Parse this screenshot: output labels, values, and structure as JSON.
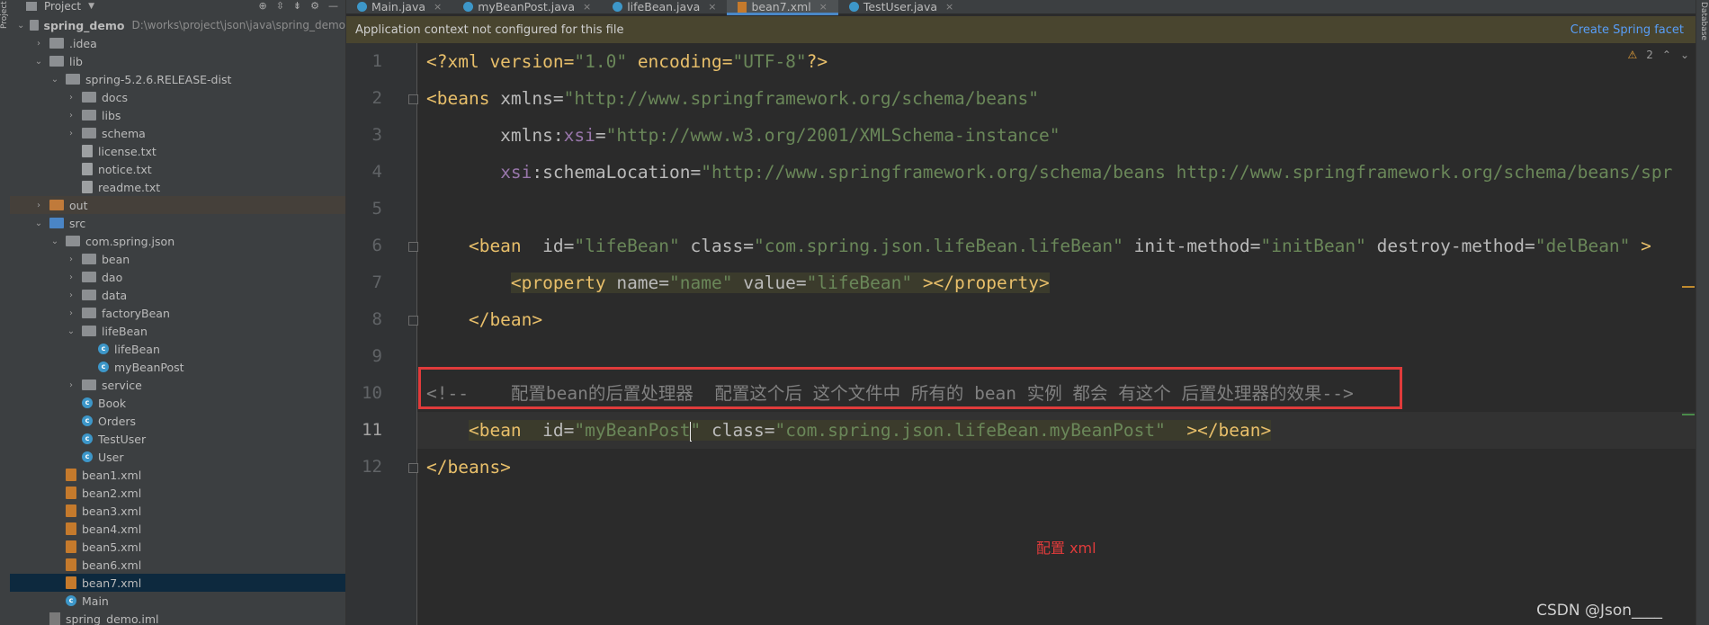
{
  "tool_windows": {
    "left": "Project",
    "right": "Database"
  },
  "project_panel": {
    "title": "Project",
    "tree": [
      {
        "label": "spring_demo",
        "path": "D:\\works\\project\\json\\java\\spring_demo",
        "depth": 0,
        "expanded": true,
        "kind": "module"
      },
      {
        "label": ".idea",
        "depth": 1,
        "expanded": false,
        "kind": "folder-grey"
      },
      {
        "label": "lib",
        "depth": 1,
        "expanded": true,
        "kind": "folder-grey"
      },
      {
        "label": "spring-5.2.6.RELEASE-dist",
        "depth": 2,
        "expanded": true,
        "kind": "folder-grey"
      },
      {
        "label": "docs",
        "depth": 3,
        "expanded": false,
        "kind": "folder-grey"
      },
      {
        "label": "libs",
        "depth": 3,
        "expanded": false,
        "kind": "folder-grey"
      },
      {
        "label": "schema",
        "depth": 3,
        "expanded": false,
        "kind": "folder-grey"
      },
      {
        "label": "license.txt",
        "depth": 3,
        "kind": "file"
      },
      {
        "label": "notice.txt",
        "depth": 3,
        "kind": "file"
      },
      {
        "label": "readme.txt",
        "depth": 3,
        "kind": "file"
      },
      {
        "label": "out",
        "depth": 1,
        "expanded": false,
        "kind": "folder-orange",
        "highlight": true
      },
      {
        "label": "src",
        "depth": 1,
        "expanded": true,
        "kind": "folder-src"
      },
      {
        "label": "com.spring.json",
        "depth": 2,
        "expanded": true,
        "kind": "package"
      },
      {
        "label": "bean",
        "depth": 3,
        "expanded": false,
        "kind": "package"
      },
      {
        "label": "dao",
        "depth": 3,
        "expanded": false,
        "kind": "package"
      },
      {
        "label": "data",
        "depth": 3,
        "expanded": false,
        "kind": "package"
      },
      {
        "label": "factoryBean",
        "depth": 3,
        "expanded": false,
        "kind": "package"
      },
      {
        "label": "lifeBean",
        "depth": 3,
        "expanded": true,
        "kind": "package"
      },
      {
        "label": "lifeBean",
        "depth": 4,
        "kind": "class"
      },
      {
        "label": "myBeanPost",
        "depth": 4,
        "kind": "class"
      },
      {
        "label": "service",
        "depth": 3,
        "expanded": false,
        "kind": "package"
      },
      {
        "label": "Book",
        "depth": 3,
        "kind": "class"
      },
      {
        "label": "Orders",
        "depth": 3,
        "kind": "class"
      },
      {
        "label": "TestUser",
        "depth": 3,
        "kind": "class"
      },
      {
        "label": "User",
        "depth": 3,
        "kind": "class"
      },
      {
        "label": "bean1.xml",
        "depth": 2,
        "kind": "xml"
      },
      {
        "label": "bean2.xml",
        "depth": 2,
        "kind": "xml"
      },
      {
        "label": "bean3.xml",
        "depth": 2,
        "kind": "xml"
      },
      {
        "label": "bean4.xml",
        "depth": 2,
        "kind": "xml"
      },
      {
        "label": "bean5.xml",
        "depth": 2,
        "kind": "xml"
      },
      {
        "label": "bean6.xml",
        "depth": 2,
        "kind": "xml"
      },
      {
        "label": "bean7.xml",
        "depth": 2,
        "kind": "xml",
        "selected": true
      },
      {
        "label": "Main",
        "depth": 2,
        "kind": "class"
      },
      {
        "label": "spring_demo.iml",
        "depth": 1,
        "kind": "iml"
      }
    ]
  },
  "tabs": [
    {
      "label": "Main.java",
      "icon": "class",
      "active": false
    },
    {
      "label": "myBeanPost.java",
      "icon": "class",
      "active": false
    },
    {
      "label": "lifeBean.java",
      "icon": "class",
      "active": false
    },
    {
      "label": "bean7.xml",
      "icon": "xml",
      "active": true
    },
    {
      "label": "TestUser.java",
      "icon": "class",
      "active": false
    }
  ],
  "banner": {
    "message": "Application context not configured for this file",
    "action": "Create Spring facet"
  },
  "inspections": {
    "warnings": "2"
  },
  "editor": {
    "current_line": 11,
    "lines": [
      {
        "n": "1",
        "tokens": [
          {
            "t": "<?xml version=",
            "c": "t-tag"
          },
          {
            "t": "\"1.0\"",
            "c": "t-val"
          },
          {
            "t": " encoding=",
            "c": "t-tag"
          },
          {
            "t": "\"UTF-8\"",
            "c": "t-val"
          },
          {
            "t": "?>",
            "c": "t-tag"
          }
        ]
      },
      {
        "n": "2",
        "tokens": [
          {
            "t": "<beans ",
            "c": "t-tag"
          },
          {
            "t": "xmlns=",
            "c": "t-attr"
          },
          {
            "t": "\"http://www.springframework.org/schema/beans\"",
            "c": "t-val"
          }
        ]
      },
      {
        "n": "3",
        "tokens": [
          {
            "t": "       xmlns:",
            "c": "t-attr"
          },
          {
            "t": "xsi",
            "c": "t-ns"
          },
          {
            "t": "=",
            "c": "t-attr"
          },
          {
            "t": "\"http://www.w3.org/2001/XMLSchema-instance\"",
            "c": "t-val"
          }
        ]
      },
      {
        "n": "4",
        "tokens": [
          {
            "t": "       ",
            "c": "t-attr"
          },
          {
            "t": "xsi",
            "c": "t-ns"
          },
          {
            "t": ":schemaLocation=",
            "c": "t-attr"
          },
          {
            "t": "\"http://www.springframework.org/schema/beans http://www.springframework.org/schema/beans/spr",
            "c": "t-val"
          }
        ]
      },
      {
        "n": "5",
        "tokens": []
      },
      {
        "n": "6",
        "tokens": [
          {
            "t": "    <bean  ",
            "c": "t-tag"
          },
          {
            "t": "id=",
            "c": "t-attr"
          },
          {
            "t": "\"lifeBean\"",
            "c": "t-val"
          },
          {
            "t": " class=",
            "c": "t-attr"
          },
          {
            "t": "\"com.spring.json.lifeBean.lifeBean\"",
            "c": "t-val"
          },
          {
            "t": " init-method=",
            "c": "t-attr"
          },
          {
            "t": "\"initBean\"",
            "c": "t-val"
          },
          {
            "t": " destroy-method=",
            "c": "t-attr"
          },
          {
            "t": "\"delBean\"",
            "c": "t-val"
          },
          {
            "t": " >",
            "c": "t-tag"
          }
        ]
      },
      {
        "n": "7",
        "tokens": [
          {
            "t": "        ",
            "c": ""
          },
          {
            "t": "<property ",
            "c": "t-tag hl-tag"
          },
          {
            "t": "name=",
            "c": "t-attr hl-tag"
          },
          {
            "t": "\"name\"",
            "c": "t-val hl-tag"
          },
          {
            "t": " value=",
            "c": "t-attr hl-tag"
          },
          {
            "t": "\"lifeBean\"",
            "c": "t-val hl-tag"
          },
          {
            "t": " ></property>",
            "c": "t-tag hl-tag"
          }
        ]
      },
      {
        "n": "8",
        "tokens": [
          {
            "t": "    </bean>",
            "c": "t-tag"
          }
        ]
      },
      {
        "n": "9",
        "tokens": []
      },
      {
        "n": "10",
        "tokens": [
          {
            "t": "<!--    配置bean的后置处理器  配置这个后 这个文件中 所有的 bean 实例 都会 有这个 后置处理器的效果-->",
            "c": "t-cmt"
          }
        ]
      },
      {
        "n": "11",
        "tokens": [
          {
            "t": "    ",
            "c": ""
          },
          {
            "t": "<bean  ",
            "c": "t-tag hl-tag"
          },
          {
            "t": "id=",
            "c": "t-attr hl-tag"
          },
          {
            "t": "\"myBeanPost",
            "c": "t-val hl-tag"
          },
          {
            "t": "CARET",
            "c": "caret"
          },
          {
            "t": "\"",
            "c": "t-val hl-tag"
          },
          {
            "t": " class=",
            "c": "t-attr hl-tag"
          },
          {
            "t": "\"com.spring.json.lifeBean.myBeanPost\"",
            "c": "t-val hl-tag"
          },
          {
            "t": "  ></bean>",
            "c": "t-tag hl-tag"
          }
        ]
      },
      {
        "n": "12",
        "tokens": [
          {
            "t": "</beans>",
            "c": "t-tag"
          }
        ]
      }
    ]
  },
  "annotation": {
    "text": "配置 xml",
    "color": "#e03b3b"
  },
  "watermark": "CSDN @Json____"
}
